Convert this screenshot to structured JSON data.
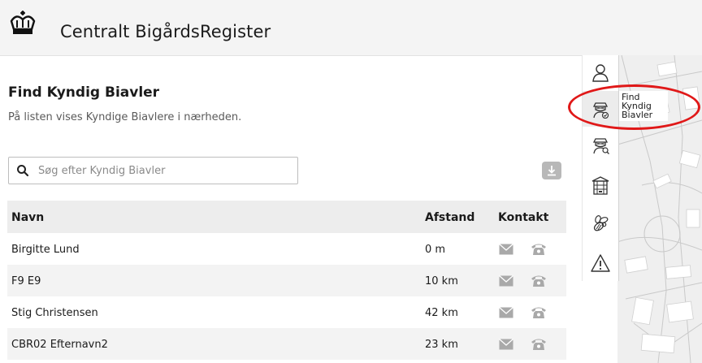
{
  "header": {
    "app_title": "Centralt BigårdsRegister"
  },
  "page": {
    "title": "Find Kyndig Biavler",
    "subtitle": "På listen vises Kyndige Biavlere i nærheden."
  },
  "search": {
    "placeholder": "Søg efter Kyndig Biavler",
    "value": ""
  },
  "table": {
    "headers": {
      "name": "Navn",
      "distance": "Afstand",
      "contact": "Kontakt"
    },
    "rows": [
      {
        "name": "Birgitte Lund",
        "distance": "0 m"
      },
      {
        "name": "F9 E9",
        "distance": "10 km"
      },
      {
        "name": "Stig Christensen",
        "distance": "42 km"
      },
      {
        "name": "CBR02 Efternavn2",
        "distance": "23 km"
      }
    ]
  },
  "toolbar": {
    "items": [
      {
        "icon": "user-icon"
      },
      {
        "icon": "beekeeper-check-icon",
        "tooltip": "Find Kyndig Biavler"
      },
      {
        "icon": "beekeeper-search-icon"
      },
      {
        "icon": "beehive-icon"
      },
      {
        "icon": "bee-icon"
      },
      {
        "icon": "warning-icon"
      }
    ]
  },
  "colors": {
    "header_bg": "#f4f4f4",
    "table_header_bg": "#ededed",
    "annotation": "#e01818",
    "icon_gray": "#9a9a9a"
  }
}
